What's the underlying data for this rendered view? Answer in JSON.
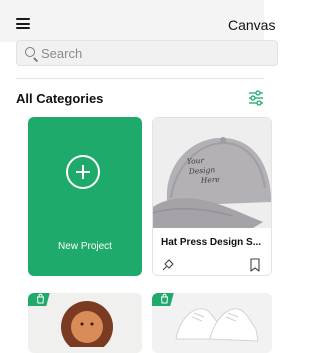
{
  "header": {
    "brand": "Canvas"
  },
  "search": {
    "placeholder": "Search"
  },
  "section": {
    "title": "All Categories"
  },
  "cards": {
    "new_project": {
      "label": "New Project"
    },
    "hat": {
      "title": "Hat Press Design S...",
      "image_text": [
        "Your",
        "Design",
        "Here"
      ]
    }
  },
  "colors": {
    "accent": "#1daa6b"
  },
  "icons": {
    "menu": "hamburger-icon",
    "search": "search-icon",
    "filter": "filter-icon",
    "pin": "pin-icon",
    "bookmark": "bookmark-icon",
    "badge": "bag-icon"
  }
}
